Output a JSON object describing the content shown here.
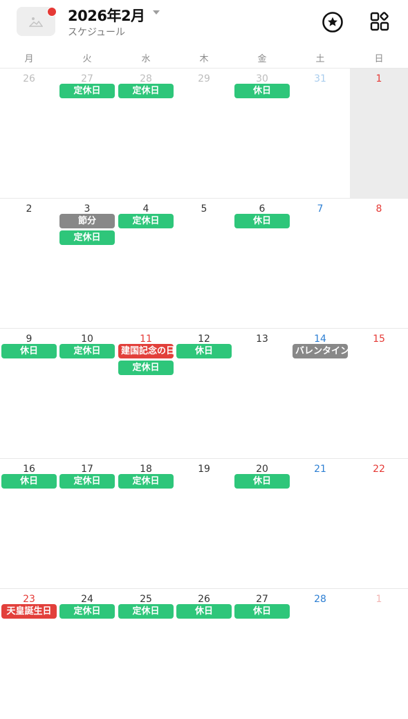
{
  "header": {
    "title": "2026年2月",
    "subtitle": "スケジュール"
  },
  "colors": {
    "green_event": "#2ec67a",
    "gray_event": "#888888",
    "red_event": "#e2403b",
    "saturday": "#2d7fd3",
    "sunday": "#e53935",
    "today_bg": "#ececec"
  },
  "icons": {
    "album": "image-placeholder-icon",
    "notification": "red-dot-badge",
    "favorite": "star-circle-icon",
    "apps": "apps-grid-icon"
  },
  "weekdays": [
    "月",
    "火",
    "水",
    "木",
    "金",
    "土",
    "日"
  ],
  "weeks": [
    {
      "days": [
        {
          "num": "26",
          "other": true,
          "events": []
        },
        {
          "num": "27",
          "other": true,
          "events": [
            {
              "label": "定休日",
              "color": "green"
            }
          ]
        },
        {
          "num": "28",
          "other": true,
          "events": [
            {
              "label": "定休日",
              "color": "green"
            }
          ]
        },
        {
          "num": "29",
          "other": true,
          "events": []
        },
        {
          "num": "30",
          "other": true,
          "events": [
            {
              "label": "休日",
              "color": "green"
            }
          ]
        },
        {
          "num": "31",
          "other": true,
          "events": []
        },
        {
          "num": "1",
          "other": false,
          "today": true,
          "events": []
        }
      ]
    },
    {
      "days": [
        {
          "num": "2",
          "events": []
        },
        {
          "num": "3",
          "events": [
            {
              "label": "節分",
              "color": "gray"
            },
            {
              "label": "定休日",
              "color": "green"
            }
          ]
        },
        {
          "num": "4",
          "events": [
            {
              "label": "定休日",
              "color": "green"
            }
          ]
        },
        {
          "num": "5",
          "events": []
        },
        {
          "num": "6",
          "events": [
            {
              "label": "休日",
              "color": "green"
            }
          ]
        },
        {
          "num": "7",
          "events": []
        },
        {
          "num": "8",
          "events": []
        }
      ]
    },
    {
      "days": [
        {
          "num": "9",
          "events": [
            {
              "label": "休日",
              "color": "green"
            }
          ]
        },
        {
          "num": "10",
          "events": [
            {
              "label": "定休日",
              "color": "green"
            }
          ]
        },
        {
          "num": "11",
          "holiday": true,
          "events": [
            {
              "label": "建国記念の日",
              "color": "red"
            },
            {
              "label": "定休日",
              "color": "green"
            }
          ]
        },
        {
          "num": "12",
          "events": [
            {
              "label": "休日",
              "color": "green"
            }
          ]
        },
        {
          "num": "13",
          "events": []
        },
        {
          "num": "14",
          "events": [
            {
              "label": "バレンタインデー",
              "color": "gray"
            }
          ]
        },
        {
          "num": "15",
          "events": []
        }
      ]
    },
    {
      "days": [
        {
          "num": "16",
          "events": [
            {
              "label": "休日",
              "color": "green"
            }
          ]
        },
        {
          "num": "17",
          "events": [
            {
              "label": "定休日",
              "color": "green"
            }
          ]
        },
        {
          "num": "18",
          "events": [
            {
              "label": "定休日",
              "color": "green"
            }
          ]
        },
        {
          "num": "19",
          "events": []
        },
        {
          "num": "20",
          "events": [
            {
              "label": "休日",
              "color": "green"
            }
          ]
        },
        {
          "num": "21",
          "events": []
        },
        {
          "num": "22",
          "events": []
        }
      ]
    },
    {
      "days": [
        {
          "num": "23",
          "holiday": true,
          "events": [
            {
              "label": "天皇誕生日",
              "color": "red"
            }
          ]
        },
        {
          "num": "24",
          "events": [
            {
              "label": "定休日",
              "color": "green"
            }
          ]
        },
        {
          "num": "25",
          "events": [
            {
              "label": "定休日",
              "color": "green"
            }
          ]
        },
        {
          "num": "26",
          "events": [
            {
              "label": "休日",
              "color": "green"
            }
          ]
        },
        {
          "num": "27",
          "events": [
            {
              "label": "休日",
              "color": "green"
            }
          ]
        },
        {
          "num": "28",
          "events": []
        },
        {
          "num": "1",
          "other": true,
          "events": []
        }
      ]
    }
  ]
}
